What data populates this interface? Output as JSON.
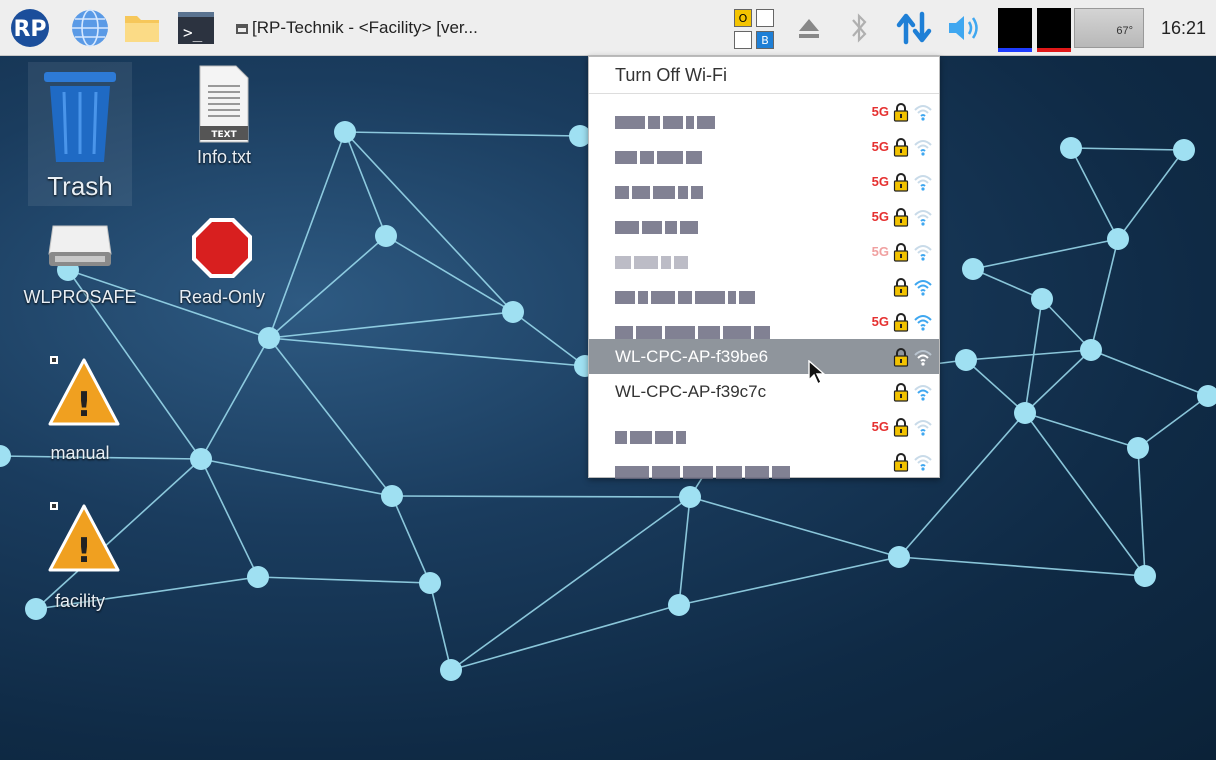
{
  "taskbar": {
    "window_title": "[RP-Technik - <Facility> [ver...",
    "clock": "16:21",
    "temperature": "67°",
    "kbd_indicators": [
      "O",
      "B"
    ],
    "icons": [
      "rp-logo-icon",
      "globe-icon",
      "folder-icon",
      "terminal-icon",
      "eject-icon",
      "bluetooth-icon",
      "network-arrows-icon",
      "volume-icon"
    ]
  },
  "desktop": {
    "icons": [
      {
        "label": "Trash"
      },
      {
        "label": "Info.txt",
        "badge": "TEXT"
      },
      {
        "label": "WLPROSAFE"
      },
      {
        "label": "Read-Only"
      },
      {
        "label": "manual"
      },
      {
        "label": "facility"
      }
    ]
  },
  "wifi_menu": {
    "top_item": "Turn Off Wi-Fi",
    "networks": [
      {
        "ssid": "",
        "redacted": true,
        "band": "5G",
        "secured": true,
        "signal": 1
      },
      {
        "ssid": "",
        "redacted": true,
        "band": "5G",
        "secured": true,
        "signal": 1
      },
      {
        "ssid": "",
        "redacted": true,
        "band": "5G",
        "secured": true,
        "signal": 1
      },
      {
        "ssid": "",
        "redacted": true,
        "band": "5G",
        "secured": true,
        "signal": 1
      },
      {
        "ssid": "",
        "redacted": true,
        "band": "5G",
        "secured": true,
        "signal": 1
      },
      {
        "ssid": "",
        "redacted": true,
        "band": "",
        "secured": true,
        "signal": 3
      },
      {
        "ssid": "",
        "redacted": true,
        "band": "5G",
        "secured": true,
        "signal": 3
      },
      {
        "ssid": "WL-CPC-AP-f39be6",
        "redacted": false,
        "band": "",
        "secured": true,
        "signal": 2,
        "hovered": true
      },
      {
        "ssid": "WL-CPC-AP-f39c7c",
        "redacted": false,
        "band": "",
        "secured": true,
        "signal": 2
      },
      {
        "ssid": "",
        "redacted": true,
        "band": "5G",
        "secured": true,
        "signal": 1
      },
      {
        "ssid": "",
        "redacted": true,
        "band": "",
        "secured": true,
        "signal": 1
      }
    ]
  },
  "colors": {
    "accent": "#1e7fd6",
    "menu_hover": "#8f959c",
    "band_5g": "#e53030",
    "lock": "#f2c200",
    "network_node": "#9fe0f2"
  }
}
